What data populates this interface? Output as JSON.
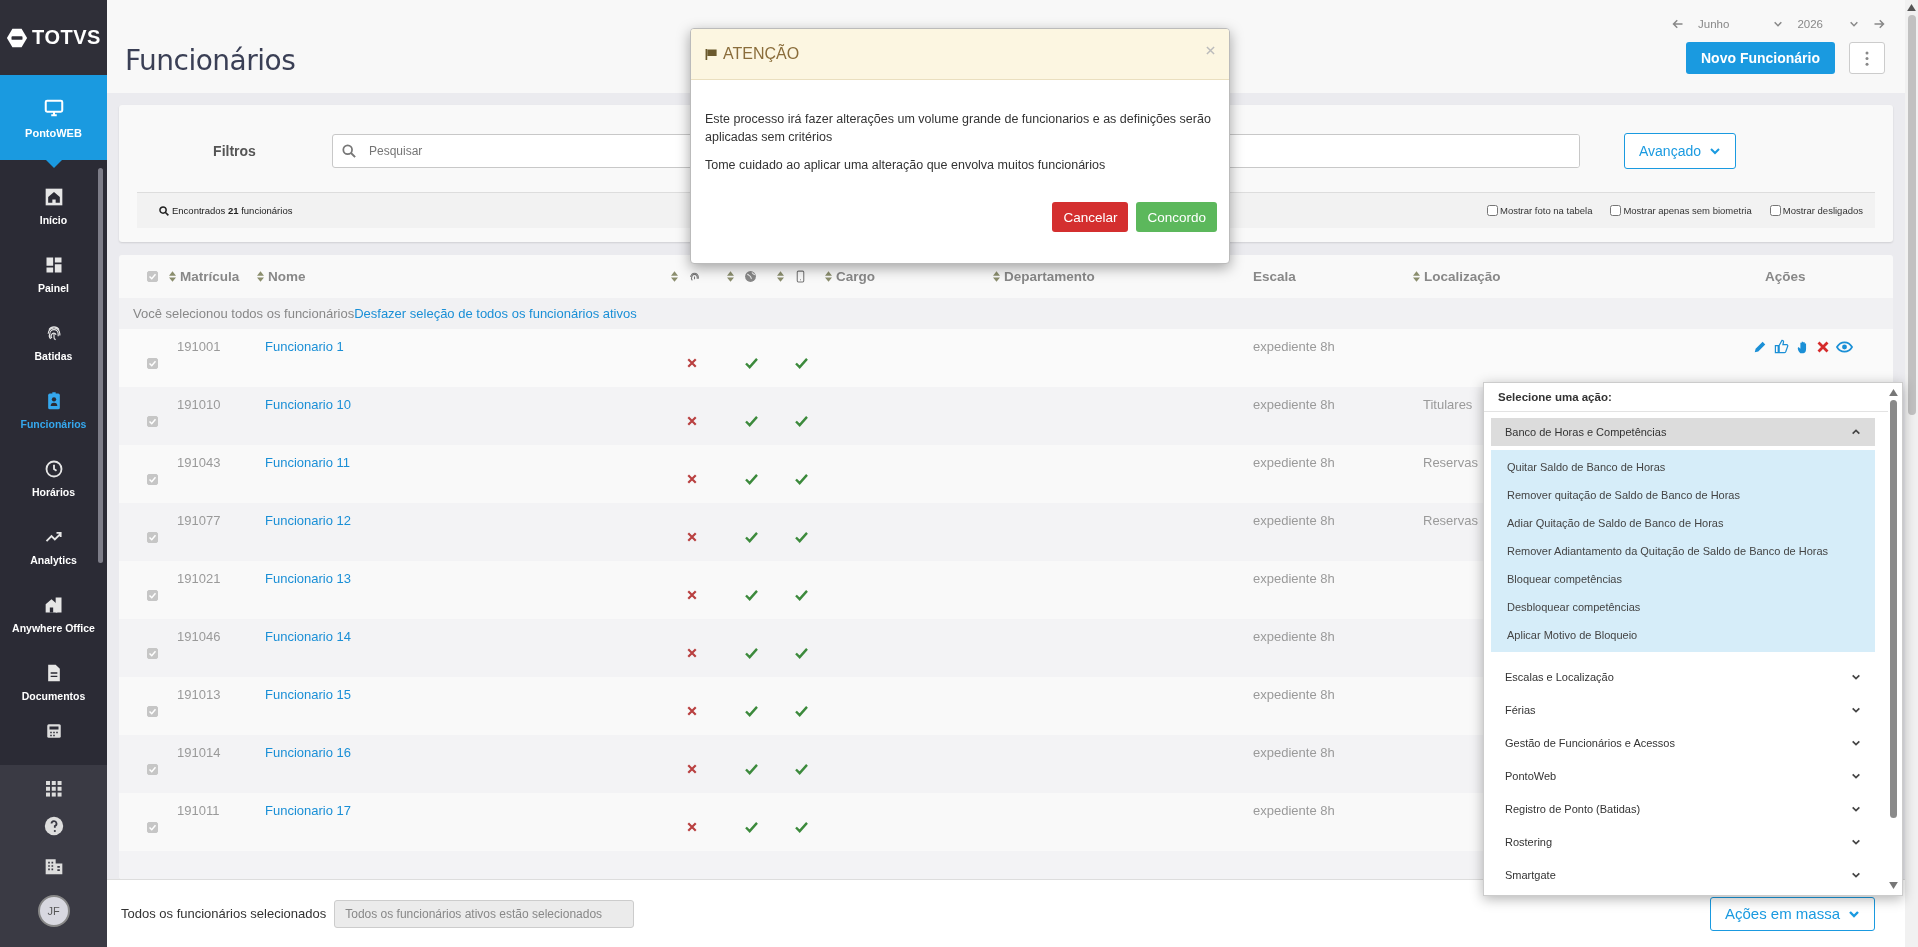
{
  "sidebar": {
    "logo": "TOTVS",
    "app": {
      "label": "PontoWEB"
    },
    "items": [
      {
        "label": "Início",
        "selected": false
      },
      {
        "label": "Painel",
        "selected": false
      },
      {
        "label": "Batidas",
        "selected": false
      },
      {
        "label": "Funcionários",
        "selected": true
      },
      {
        "label": "Horários",
        "selected": false
      },
      {
        "label": "Analytics",
        "selected": false
      },
      {
        "label": "Anywhere Office",
        "selected": false
      },
      {
        "label": "Documentos",
        "selected": false
      }
    ],
    "avatar": "JF"
  },
  "header": {
    "title": "Funcionários",
    "month": "Junho",
    "year": "2026",
    "new_button": "Novo Funcionário"
  },
  "filters": {
    "label": "Filtros",
    "search": {
      "placeholder": "Pesquisar"
    },
    "advanced_button": "Avançado",
    "found": "Encontrados **21** funcionários",
    "options": [
      {
        "label": "Mostrar foto na tabela",
        "checked": false
      },
      {
        "label": "Mostrar apenas sem biometria",
        "checked": false
      },
      {
        "label": "Mostrar desligados",
        "checked": false
      }
    ]
  },
  "table": {
    "all_selected": true,
    "columns": [
      {
        "kind": "text",
        "label": "Matrícula",
        "sortable": true
      },
      {
        "kind": "text",
        "label": "Nome",
        "sortable": true
      },
      {
        "kind": "biometry",
        "sortable": true
      },
      {
        "kind": "web",
        "sortable": true
      },
      {
        "kind": "app",
        "sortable": true
      },
      {
        "kind": "text",
        "label": "Cargo",
        "sortable": true
      },
      {
        "kind": "text",
        "label": "Departamento",
        "sortable": true
      },
      {
        "kind": "text",
        "label": "Escala",
        "sortable": false
      },
      {
        "kind": "text",
        "label": "Localização",
        "sortable": true
      },
      {
        "kind": "text",
        "label": "Ações",
        "sortable": false
      }
    ],
    "notice": {
      "text": "Você selecionou todos os funcionários",
      "link": "Desfazer seleção de todos os funcionários ativos"
    },
    "rows": [
      {
        "selected": true,
        "matricula": "191001",
        "name": "Funcionario 1",
        "biometry": false,
        "web": true,
        "app": true,
        "scale": "expediente 8h",
        "actions": true
      },
      {
        "selected": true,
        "matricula": "191010",
        "name": "Funcionario 10",
        "biometry": false,
        "web": true,
        "app": true,
        "scale": "expediente 8h",
        "location": "Titulares",
        "actions": false
      },
      {
        "selected": true,
        "matricula": "191043",
        "name": "Funcionario 11",
        "biometry": false,
        "web": true,
        "app": true,
        "scale": "expediente 8h",
        "location": "Reservas",
        "actions": false
      },
      {
        "selected": true,
        "matricula": "191077",
        "name": "Funcionario 12",
        "biometry": false,
        "web": true,
        "app": true,
        "scale": "expediente 8h",
        "location": "Reservas",
        "actions": false
      },
      {
        "selected": true,
        "matricula": "191021",
        "name": "Funcionario 13",
        "biometry": false,
        "web": true,
        "app": true,
        "scale": "expediente 8h",
        "actions": false
      },
      {
        "selected": true,
        "matricula": "191046",
        "name": "Funcionario 14",
        "biometry": false,
        "web": true,
        "app": true,
        "scale": "expediente 8h",
        "actions": false
      },
      {
        "selected": true,
        "matricula": "191013",
        "name": "Funcionario 15",
        "biometry": false,
        "web": true,
        "app": true,
        "scale": "expediente 8h",
        "actions": false
      },
      {
        "selected": true,
        "matricula": "191014",
        "name": "Funcionario 16",
        "biometry": false,
        "web": true,
        "app": true,
        "scale": "expediente 8h",
        "actions": false
      },
      {
        "selected": true,
        "matricula": "191011",
        "name": "Funcionario 17",
        "biometry": false,
        "web": true,
        "app": true,
        "scale": "expediente 8h",
        "actions": false
      }
    ]
  },
  "modal": {
    "title": "ATENÇÃO",
    "paragraphs": [
      "Este processo irá fazer alterações um volume grande de funcionarios e as definições serão aplicadas sem critérios",
      "Tome cuidado ao aplicar uma alteração que envolva muitos funcionários"
    ],
    "buttons": [
      {
        "label": "Cancelar",
        "kind": "danger"
      },
      {
        "label": "Concordo",
        "kind": "success"
      }
    ]
  },
  "action_menu": {
    "title": "Selecione uma ação:",
    "groups": [
      {
        "label": "Banco de Horas e Competências",
        "expanded": true,
        "items": [
          "Quitar Saldo de Banco de Horas",
          "Remover quitação de Saldo de Banco de Horas",
          "Adiar Quitação de Saldo de Banco de Horas",
          "Remover Adiantamento da Quitação de Saldo de Banco de Horas",
          "Bloquear competências",
          "Desbloquear competências",
          "Aplicar Motivo de Bloqueio"
        ]
      },
      {
        "label": "Escalas e Localização",
        "expanded": false
      },
      {
        "label": "Férias",
        "expanded": false
      },
      {
        "label": "Gestão de Funcionários e Acessos",
        "expanded": false
      },
      {
        "label": "PontoWeb",
        "expanded": false
      },
      {
        "label": "Registro de Ponto (Batidas)",
        "expanded": false
      },
      {
        "label": "Rostering",
        "expanded": false
      },
      {
        "label": "Smartgate",
        "expanded": false
      }
    ]
  },
  "footer": {
    "label": "Todos os funcionários selecionados",
    "field": {
      "value": "Todos os funcionários ativos estão selecionados",
      "disabled": true
    },
    "mass_button": "Ações em massa"
  }
}
